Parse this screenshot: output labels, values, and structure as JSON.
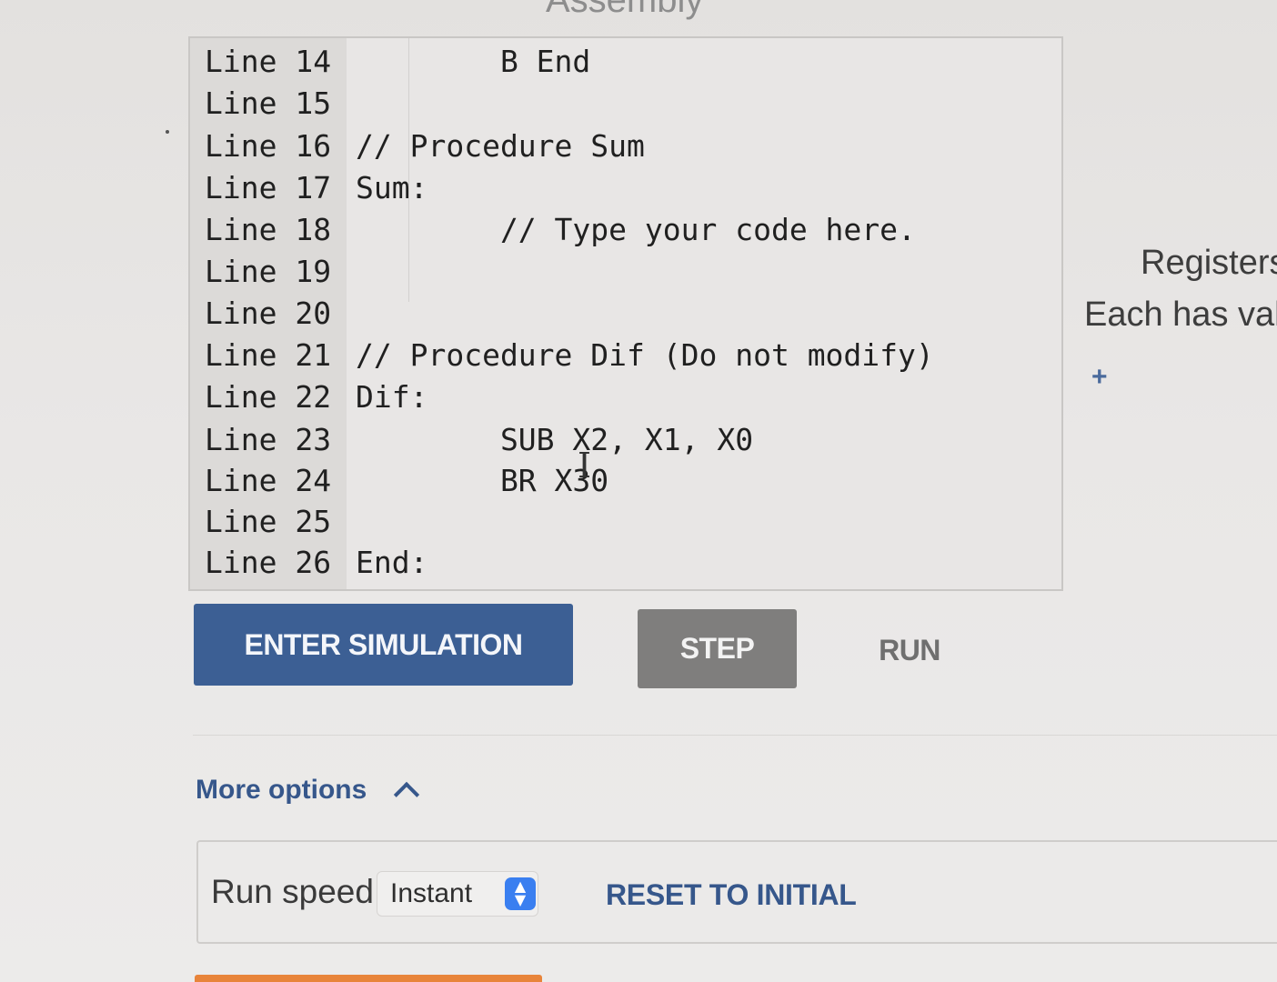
{
  "page": {
    "top_title": "Assembly"
  },
  "editor": {
    "lines": [
      {
        "number": "Line 14",
        "code": "        B End"
      },
      {
        "number": "Line 15",
        "code": ""
      },
      {
        "number": "Line 16",
        "code": "// Procedure Sum"
      },
      {
        "number": "Line 17",
        "code": "Sum:"
      },
      {
        "number": "Line 18",
        "code": "        // Type your code here."
      },
      {
        "number": "Line 19",
        "code": ""
      },
      {
        "number": "Line 20",
        "code": ""
      },
      {
        "number": "Line 21",
        "code": "// Procedure Dif (Do not modify)"
      },
      {
        "number": "Line 22",
        "code": "Dif:"
      },
      {
        "number": "Line 23",
        "code": "        SUB X2, X1, X0"
      },
      {
        "number": "Line 24",
        "code": "        BR X30"
      },
      {
        "number": "Line 25",
        "code": ""
      },
      {
        "number": "Line 26",
        "code": "End:"
      }
    ]
  },
  "controls": {
    "enter_simulation_label": "ENTER SIMULATION",
    "step_label": "STEP",
    "run_label": "RUN"
  },
  "registers": {
    "title": "Registers",
    "description": "Each has val",
    "add_label": "+"
  },
  "more_options": {
    "label": "More options",
    "run_speed_label": "Run speed",
    "run_speed_value": "Instant",
    "reset_label": "RESET TO INITIAL"
  },
  "icons": {
    "chevron": "chevron-up-icon",
    "select_arrows": "select-updown-icon",
    "text_cursor": "text-cursor-icon"
  },
  "colors": {
    "primary_button": "#3c5f94",
    "step_button": "#7f7e7d",
    "link_text": "#36578b",
    "select_accent": "#3a7ff0"
  }
}
